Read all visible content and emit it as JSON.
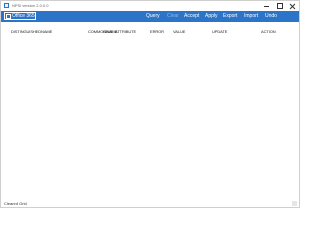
{
  "window": {
    "title": "NPSi version 2.0.0.0"
  },
  "toolbar": {
    "brand_label": "Office 365",
    "menu": [
      {
        "label": "Query",
        "enabled": true
      },
      {
        "label": "Clear",
        "enabled": false
      },
      {
        "label": "Accept",
        "enabled": true
      },
      {
        "label": "Apply",
        "enabled": true
      },
      {
        "label": "Export",
        "enabled": true
      },
      {
        "label": "Import",
        "enabled": true
      },
      {
        "label": "Undo",
        "enabled": true
      }
    ],
    "accent_color": "#2b74c8"
  },
  "grid": {
    "columns": [
      "DISTINGUISHEDNAME",
      "COMMONNAME",
      "OBJE",
      "ATTRIBUTE",
      "ERROR",
      "VALUE",
      "UPDATE",
      "ACTION"
    ],
    "rows": []
  },
  "status": {
    "text": "Cleared Grid"
  }
}
